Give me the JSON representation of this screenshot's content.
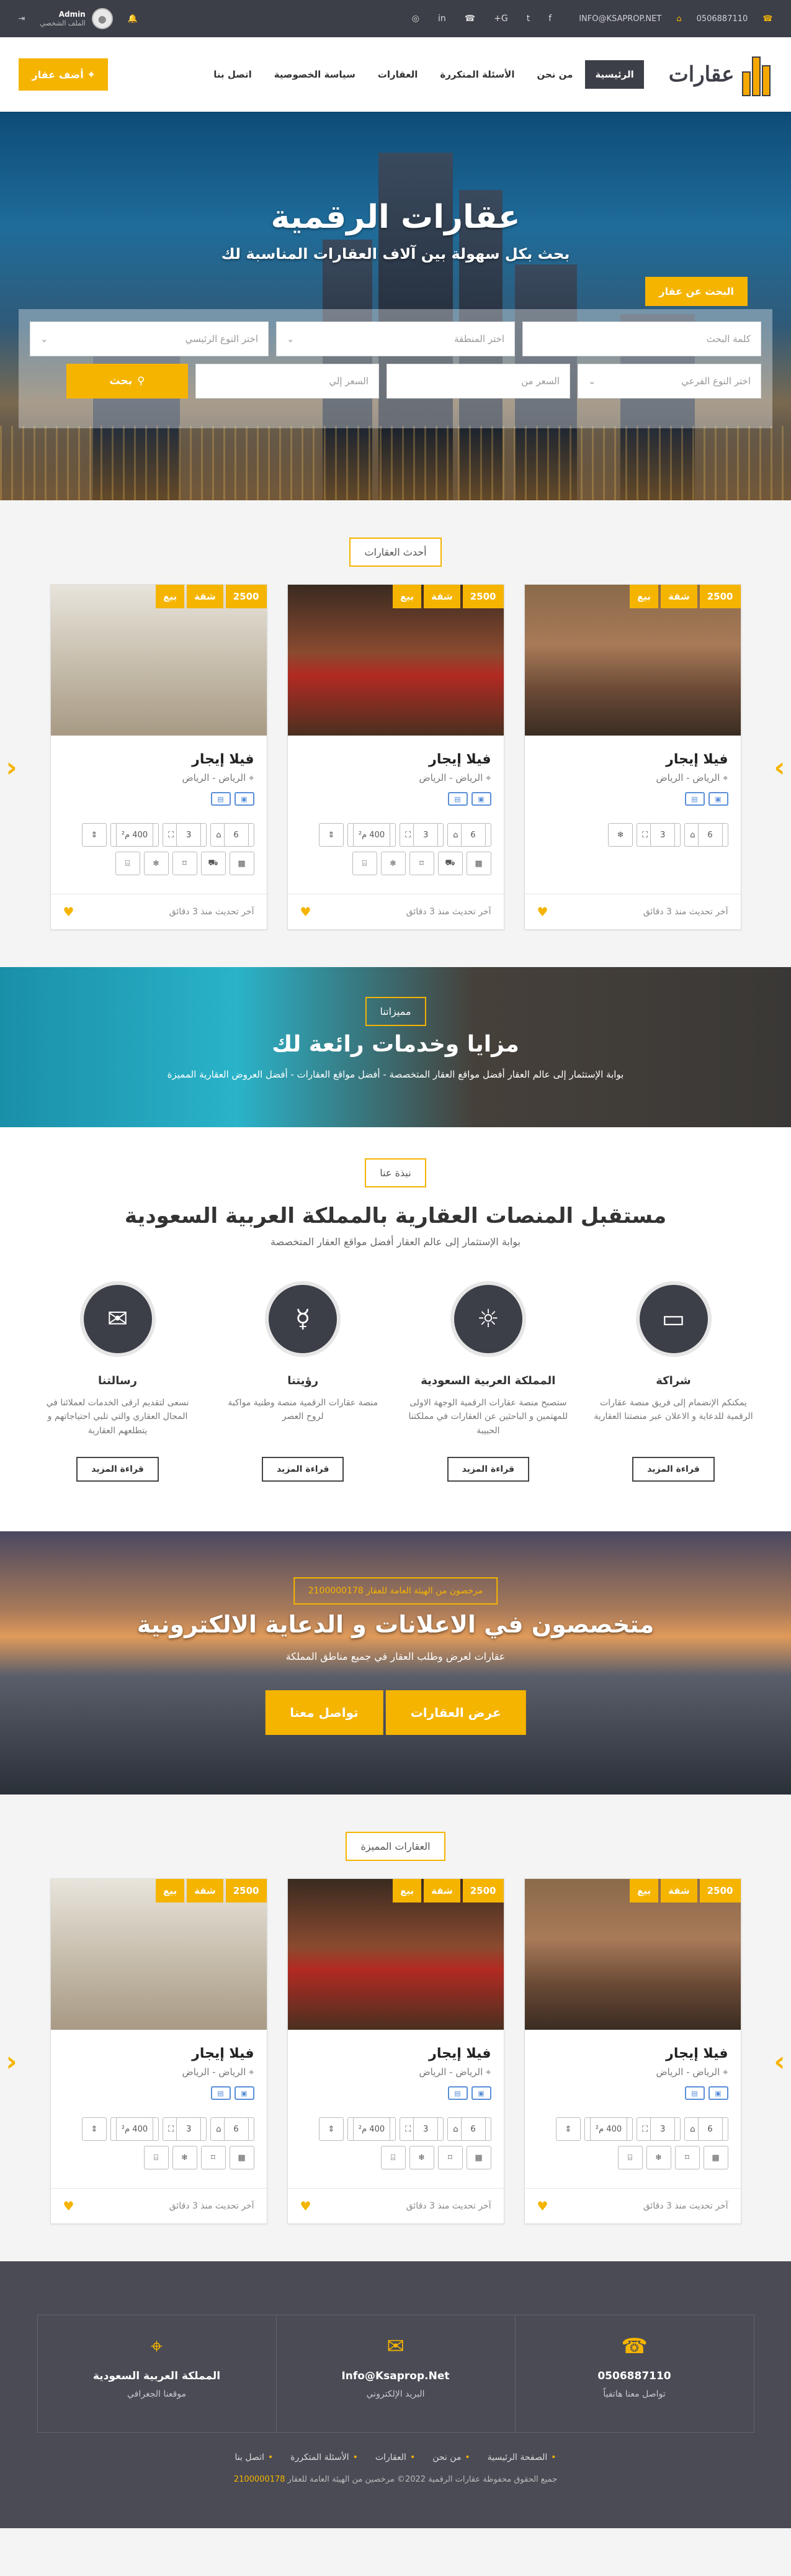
{
  "topbar": {
    "phone": "0506887110",
    "email": "INFO@KSAPROP.NET",
    "social": [
      "f",
      "t",
      "G+",
      "☎",
      "in",
      "◎"
    ],
    "user_name": "Admin",
    "user_role": "الملف الشخصي"
  },
  "nav": {
    "logo_text": "عقارات",
    "items": [
      "الرئيسية",
      "من نحن",
      "الأسئلة المتكررة",
      "العقارات",
      "سياسة الخصوصية",
      "اتصل بنا"
    ],
    "add_button": "أضف عقار"
  },
  "hero": {
    "title": "عقارات الرقمية",
    "subtitle": "بحث بكل سهولة بين آلاف العقارات المناسبة لك",
    "search_tab": "البحث عن عقار",
    "fields": {
      "keyword": "كلمة البحث",
      "region": "اختر المنطقة",
      "main_type": "اختر النوع الرئيسي",
      "sub_type": "اختر النوع الفرعي",
      "price_from": "السعر من",
      "price_to": "السعر إلي"
    },
    "search_button": "بحث"
  },
  "latest": {
    "label": "أحدث العقارات",
    "cards": [
      {
        "title": "فيلا إيجار",
        "location": "الرياض - الرياض",
        "tags": [
          "2500",
          "شقة",
          "بيع"
        ],
        "features": [
          "6",
          "3"
        ],
        "updated": "آخر تحديث منذ 3 دقائق"
      },
      {
        "title": "فيلا إيجار",
        "location": "الرياض - الرياض",
        "tags": [
          "2500",
          "شقة",
          "بيع"
        ],
        "features": [
          "6",
          "3",
          "400 م²"
        ],
        "updated": "آخر تحديث منذ 3 دقائق"
      },
      {
        "title": "فيلا إيجار",
        "location": "الرياض - الرياض",
        "tags": [
          "2500",
          "شقة",
          "بيع"
        ],
        "features": [
          "6",
          "3",
          "400 م²"
        ],
        "updated": "آخر تحديث منذ 3 دقائق"
      }
    ]
  },
  "features_band": {
    "label": "مميزاتنا",
    "title": "مزايا وخدمات رائعة لك",
    "text": "بوابة الإستثمار إلى عالم العقار أفضل مواقع العقار المتخصصة - أفضل مواقع العقارات - أفضل العروض العقارية المميزة"
  },
  "about": {
    "label": "نبذة عنا",
    "title": "مستقبل المنصات العقارية بالمملكة العربية السعودية",
    "subtitle": "بوابة الإستثمار إلى عالم العقار أفضل مواقع العقار المتخصصة",
    "more": "قراءة المزيد",
    "cols": [
      {
        "title": "شراكة",
        "text": "يمكنكم الإنضمام إلى فريق منصة عقارات الرقمية للدعاية و الاعلان عبر منصتنا العقارية"
      },
      {
        "title": "المملكة العربية السعودية",
        "text": "ستصبح منصة عقارات الرقمية الوجهة الاولى للمهتمين و الباحثين عن العقارات في مملكتنا الحبيبة"
      },
      {
        "title": "رؤيتنا",
        "text": "منصة عقارات الرقمية منصة وطنية مواكبة لروح العصر"
      },
      {
        "title": "رسالتنا",
        "text": "نسعى لتقديم ارقى الخدمات لعملائنا في المجال العقاري والتي تلبي احتياجاتهم و يتطلعهم العقارية"
      }
    ]
  },
  "promo": {
    "license": "مرخصون من الهيئة العامة للعقار 2100000178",
    "title": "متخصصون في الاعلانات و الدعاية الالكترونية",
    "text": "عقارات لعرض وطلب العقار في جميع مناطق المملكة",
    "btn_props": "عرض العقارات",
    "btn_contact": "تواصل معنا"
  },
  "featured": {
    "label": "العقارات المميزة",
    "cards": [
      {
        "title": "فيلا إيجار",
        "location": "الرياض - الرياض",
        "tags": [
          "2500",
          "شقة",
          "بيع"
        ],
        "features": [
          "6",
          "3",
          "400 م²"
        ],
        "updated": "آخر تحديث منذ 3 دقائق"
      },
      {
        "title": "فيلا إيجار",
        "location": "الرياض - الرياض",
        "tags": [
          "2500",
          "شقة",
          "بيع"
        ],
        "features": [
          "6",
          "3",
          "400 م²"
        ],
        "updated": "آخر تحديث منذ 3 دقائق"
      },
      {
        "title": "فيلا إيجار",
        "location": "الرياض - الرياض",
        "tags": [
          "2500",
          "شقة",
          "بيع"
        ],
        "features": [
          "6",
          "3",
          "400 م²"
        ],
        "updated": "آخر تحديث منذ 3 دقائق"
      }
    ]
  },
  "footer": {
    "phone": "0506887110",
    "phone_label": "تواصل معنا هاتفياً",
    "email": "Info@Ksaprop.Net",
    "email_label": "البريد الإلكتروني",
    "location": "المملكة العربية السعودية",
    "location_label": "موقعنا الجغرافي",
    "links": [
      "الصفحة الرئيسية",
      "من نحن",
      "العقارات",
      "الأسئلة المتكررة",
      "اتصل بنا"
    ],
    "copyright": "جميع الحقوق محفوظة عقارات الرقمية 2022© مرخصين من الهيئة العامة للعقار",
    "license_no": "2100000178"
  },
  "colors": {
    "accent": "#f5b400",
    "dark": "#3d3f48"
  }
}
